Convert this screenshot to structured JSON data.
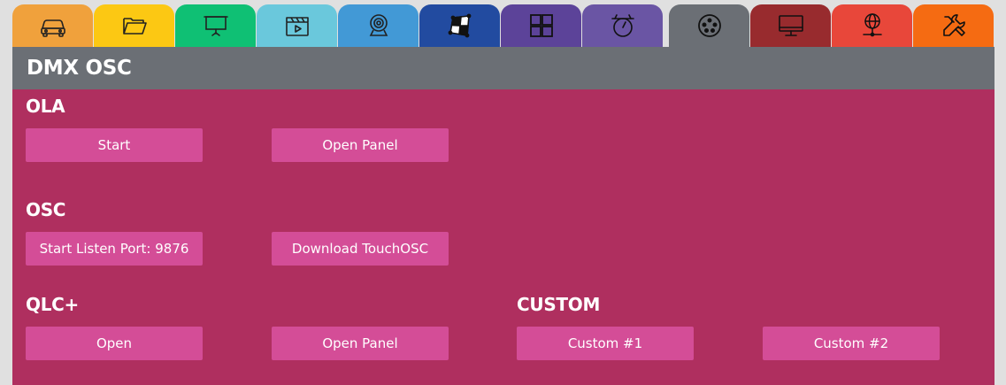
{
  "tabs": [
    {
      "icon": "car-icon",
      "color": "#f0a13c"
    },
    {
      "icon": "folder-icon",
      "color": "#fcc813"
    },
    {
      "icon": "projector-screen-icon",
      "color": "#0fc074"
    },
    {
      "icon": "clapperboard-icon",
      "color": "#6ac8dc"
    },
    {
      "icon": "webcam-icon",
      "color": "#4299d6"
    },
    {
      "icon": "mapping-icon",
      "color": "#224ba0"
    },
    {
      "icon": "grid-icon",
      "color": "#5c4399"
    },
    {
      "icon": "timer-icon",
      "color": "#6a55a4"
    },
    {
      "icon": "dmx-connector-icon",
      "color": "#6b6f75",
      "active": true
    },
    {
      "icon": "monitor-icon",
      "color": "#982b2e"
    },
    {
      "icon": "network-icon",
      "color": "#e8473a"
    },
    {
      "icon": "tools-icon",
      "color": "#f56b12"
    }
  ],
  "panel": {
    "title": "DMX OSC",
    "background": "#af2f5f",
    "header_color": "#6b6f75",
    "button_color": "#d44d97"
  },
  "sections": {
    "ola": {
      "title": "OLA",
      "start_label": "Start",
      "open_panel_label": "Open Panel"
    },
    "osc": {
      "title": "OSC",
      "listen_label": "Start Listen Port: 9876",
      "download_label": "Download TouchOSC"
    },
    "qlc": {
      "title": "QLC+",
      "open_label": "Open",
      "open_panel_label": "Open Panel"
    },
    "custom": {
      "title": "CUSTOM",
      "custom1_label": "Custom #1",
      "custom2_label": "Custom #2"
    }
  }
}
